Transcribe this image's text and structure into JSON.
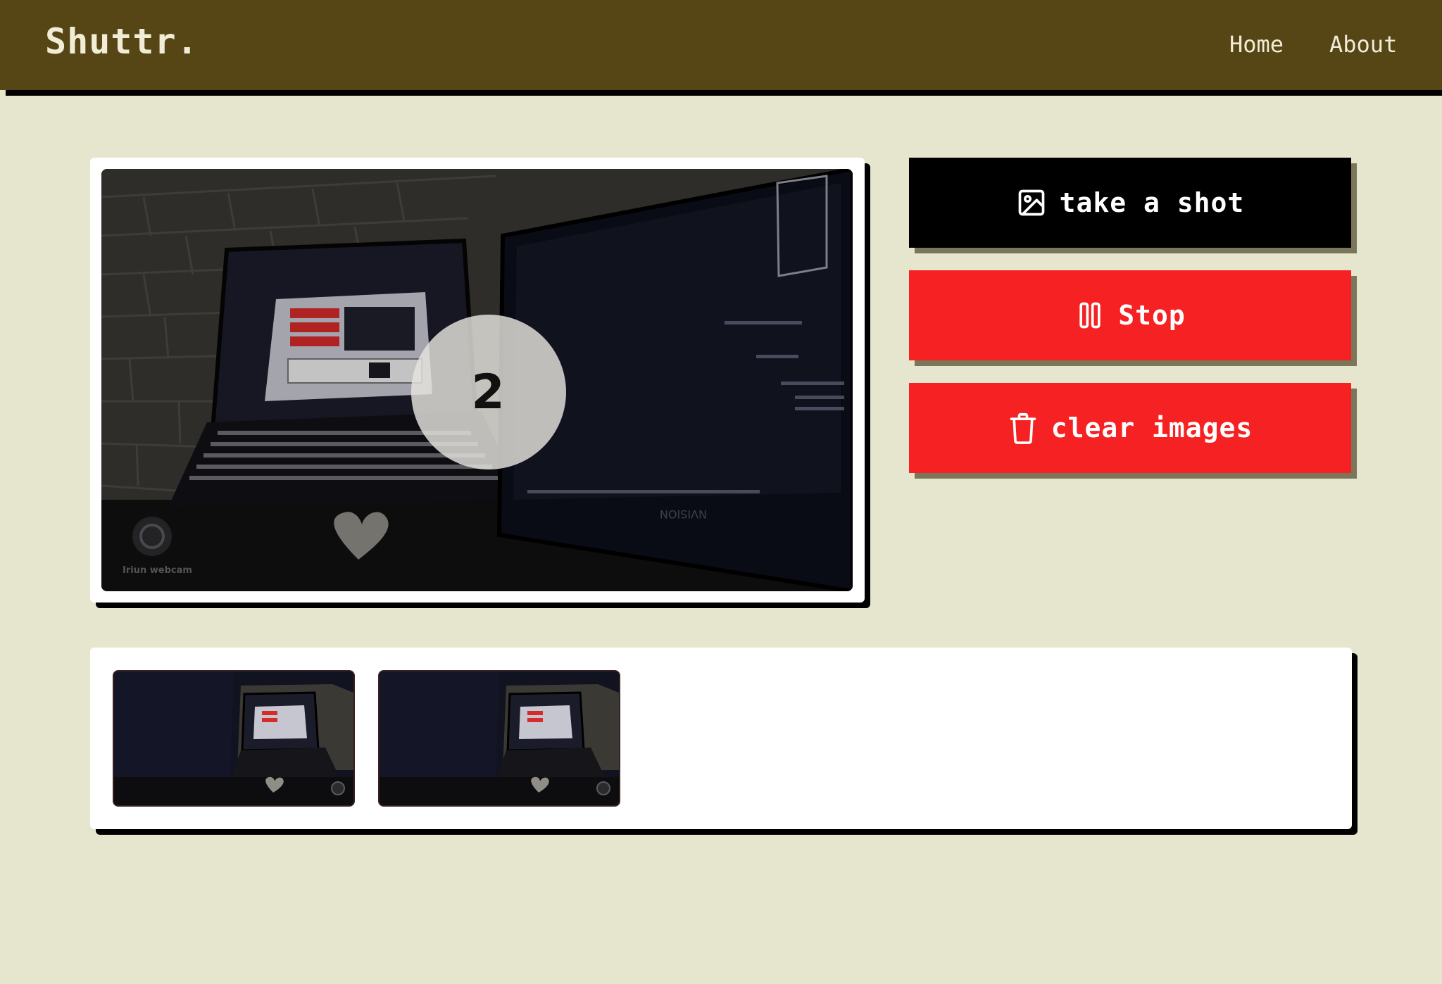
{
  "navbar": {
    "brand": "Shuttr.",
    "links": [
      {
        "label": "Home"
      },
      {
        "label": "About"
      }
    ]
  },
  "camera": {
    "countdown": "2",
    "watermark": "Iriun webcam",
    "monitor_brand": "NVISION"
  },
  "actions": {
    "take_shot": {
      "label": "take a shot",
      "icon": "image-icon"
    },
    "stop": {
      "label": "Stop",
      "icon": "pause-icon"
    },
    "clear": {
      "label": "clear images",
      "icon": "trash-icon"
    }
  },
  "gallery": {
    "thumbnails": [
      {
        "name": "captured-image-1"
      },
      {
        "name": "captured-image-2"
      }
    ]
  },
  "colors": {
    "navbar": "#564615",
    "background": "#e6e6cf",
    "primary_button": "#000000",
    "danger_button": "#f52122"
  }
}
